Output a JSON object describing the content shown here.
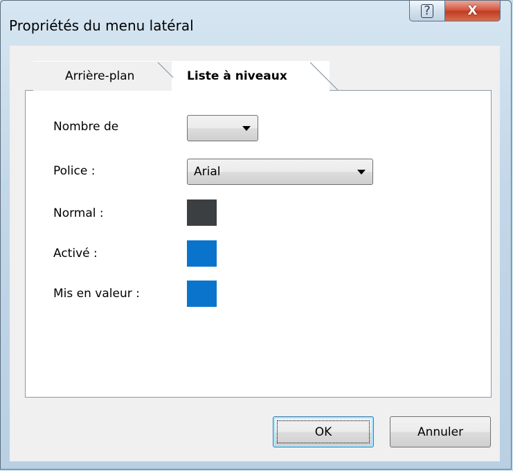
{
  "window": {
    "title": "Propriétés du menu latéral",
    "help_symbol": "?",
    "close_symbol": "X"
  },
  "tabs": [
    {
      "label": "Arrière-plan",
      "active": false
    },
    {
      "label": "Liste à niveaux",
      "active": true
    }
  ],
  "form": {
    "nombre": {
      "label": "Nombre de",
      "value": ""
    },
    "police": {
      "label": "Police :",
      "value": "Arial"
    },
    "normal": {
      "label": "Normal :",
      "color": "#3c3f41"
    },
    "active": {
      "label": "Activé :",
      "color": "#0a74cc"
    },
    "highlight": {
      "label": "Mis en valeur :",
      "color": "#0a74cc"
    }
  },
  "buttons": {
    "ok": "OK",
    "cancel": "Annuler"
  }
}
